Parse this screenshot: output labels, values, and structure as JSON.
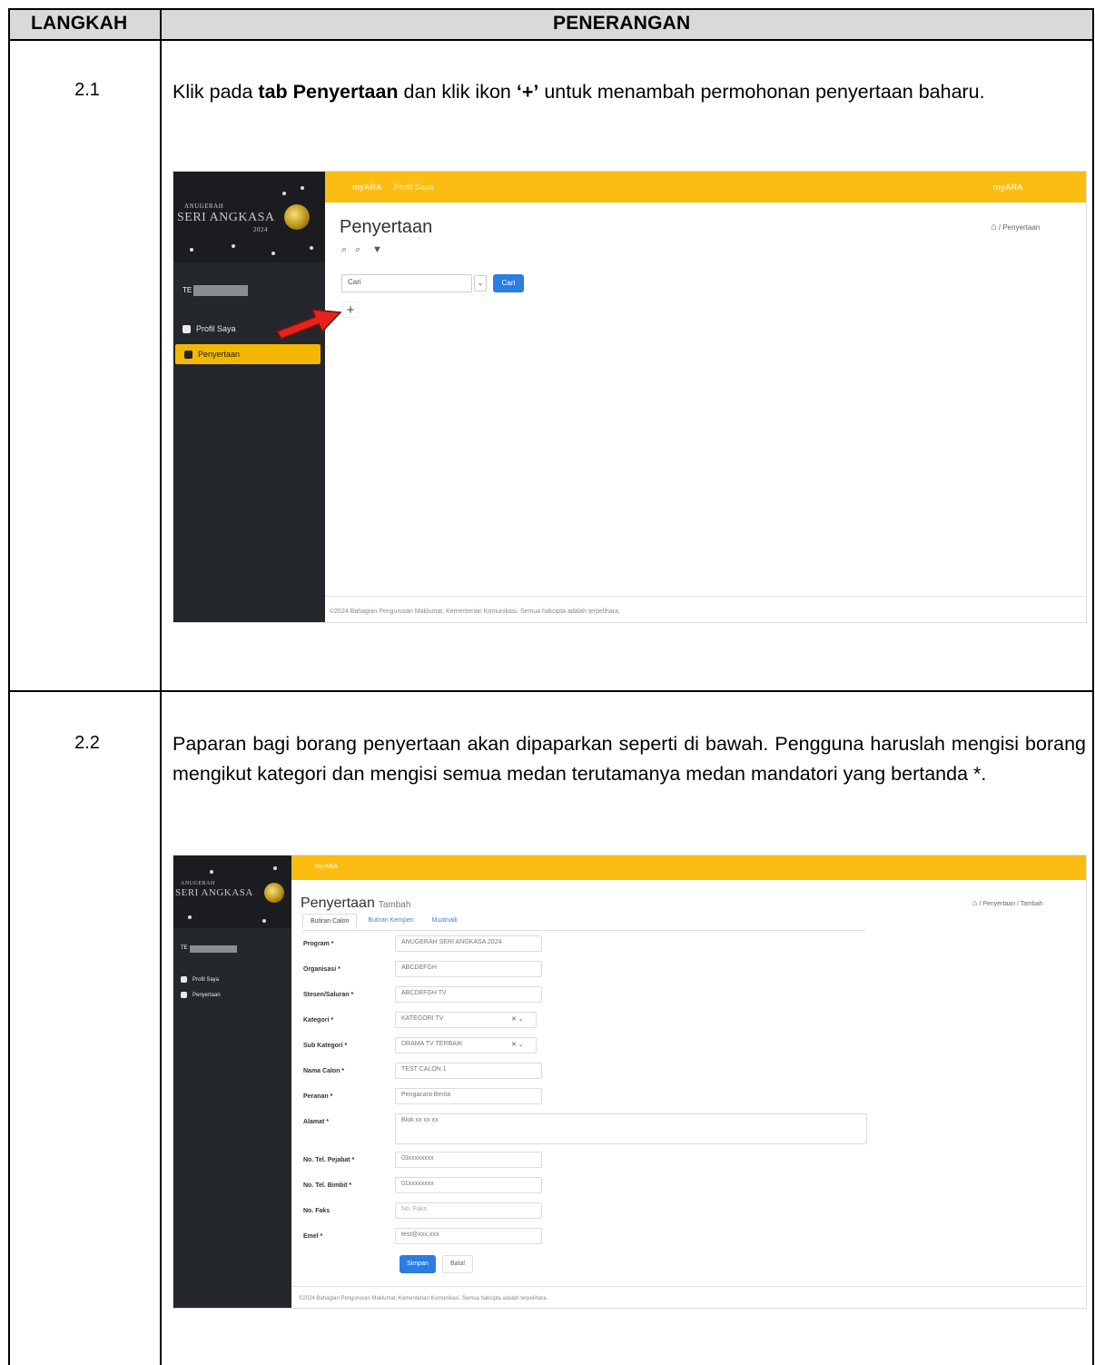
{
  "header": {
    "col1": "LANGKAH",
    "col2": "PENERANGAN"
  },
  "steps": [
    {
      "number": "2.1",
      "text_parts": [
        "Klik pada ",
        "tab Penyertaan",
        " dan klik ikon ",
        "‘+’",
        " untuk menambah permohonan penyertaan baharu."
      ]
    },
    {
      "number": "2.2",
      "text": "Paparan bagi borang penyertaan akan dipaparkan seperti di bawah. Pengguna haruslah mengisi borang mengikut kategori dan mengisi semua medan terutamanya medan mandatori yang bertanda *."
    }
  ],
  "screenshot1": {
    "logo_small": "ANUGERAH",
    "logo_big": "SERI ANGKASA",
    "year": "2024",
    "topbar_app": "myARA",
    "topbar_menu": "Profil Saya",
    "topbar_right": [
      "myARA"
    ],
    "user_prefix": "TE",
    "nav": [
      "Profil Saya",
      "Penyertaan"
    ],
    "page_title": "Penyertaan",
    "breadcrumb": "/ Penyertaan",
    "search_placeholder": "Cari",
    "search_button": "Cari",
    "add_icon": "+",
    "footer": "©2024 Bahagian Pengurusan Maklumat, Kementerian Komunikasi. Semua hakcipta adalah terpelihara."
  },
  "screenshot2": {
    "logo_small": "ANUGERAH",
    "logo_big": "SERI ANGKASA",
    "topbar_app": "myARA",
    "user_prefix": "TE",
    "nav": [
      "Profil Saya",
      "Penyertaan"
    ],
    "page_title": "Penyertaan",
    "page_subtitle": "Tambah",
    "breadcrumb": "/ Penyertaan / Tambah",
    "tabs": [
      "Butiran Calon",
      "Butiran Kempen",
      "Muatnaik"
    ],
    "fields": [
      {
        "label": "Program *",
        "value": "ANUGERAH SERI ANGKASA 2024"
      },
      {
        "label": "Organisasi *",
        "value": "ABCDEFGH"
      },
      {
        "label": "Stesen/Saluran *",
        "value": "ABCDEFGH TV"
      },
      {
        "label": "Kategori *",
        "value": "KATEGORI TV"
      },
      {
        "label": "Sub Kategori *",
        "value": "DRAMA TV TERBAIK"
      },
      {
        "label": "Nama Calon *",
        "value": "TEST CALON 1"
      },
      {
        "label": "Peranan *",
        "value": "Pengacara Berita"
      },
      {
        "label": "Alamat *",
        "value": "Blok xx xx xx"
      },
      {
        "label": "No. Tel. Pejabat *",
        "value": "03xxxxxxxx"
      },
      {
        "label": "No. Tel. Bimbit *",
        "value": "01xxxxxxxx"
      },
      {
        "label": "No. Faks",
        "value": "No. Faks"
      },
      {
        "label": "Emel *",
        "value": "test@xxx.xxx"
      }
    ],
    "save_button": "Simpan",
    "cancel_button": "Batal",
    "footer": "©2024 Bahagian Pengurusan Maklumat, Kementerian Komunikasi. Semua hakcipta adalah terpelihara."
  }
}
